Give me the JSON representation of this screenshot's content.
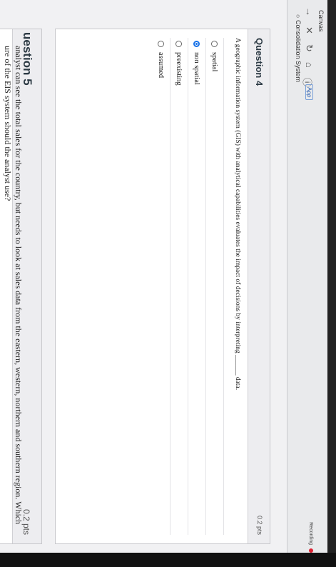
{
  "browser": {
    "tab_title": "Canvas",
    "address_chip": "Aρρ",
    "page_tab_label": "Consolidation System",
    "status_label": "Recording"
  },
  "question4": {
    "title": "Question 4",
    "points": "0.2 pts",
    "prompt": "A geographic information system (GIS) with analytical capabilities evaluates the impact of decisions by interpreting ______ data.",
    "options": [
      {
        "label": "spatial",
        "selected": false
      },
      {
        "label": "non spatial",
        "selected": true
      },
      {
        "label": "preexisting",
        "selected": false
      },
      {
        "label": "assumed",
        "selected": false
      }
    ]
  },
  "question5": {
    "title": "uestion 5",
    "points": "0.2 pts",
    "prompt_line1": "analyst can see the total sales for the country, but needs to look at sales data from the eastern, western, northern and southern region. Which",
    "prompt_line2": "ure of the EIS system should the analyst use?"
  },
  "colors": {
    "accent": "#1a73e8",
    "heading": "#2d3b45",
    "status": "#dd2233"
  }
}
